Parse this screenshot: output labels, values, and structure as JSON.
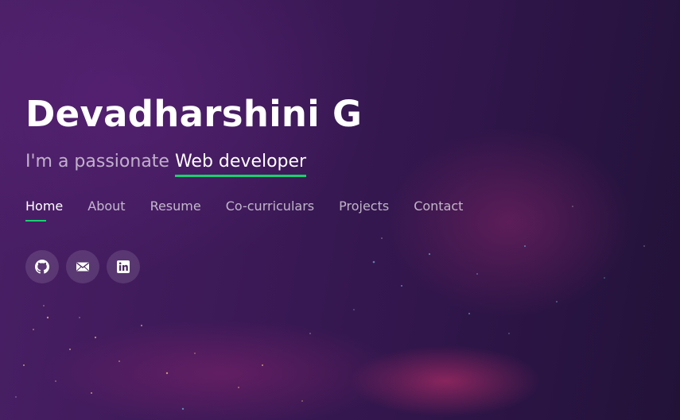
{
  "header": {
    "name": "Devadharshini G",
    "tagline_prefix": "I'm a passionate",
    "tagline_typed": "Web developer"
  },
  "nav": {
    "items": [
      {
        "label": "Home",
        "active": true
      },
      {
        "label": "About",
        "active": false
      },
      {
        "label": "Resume",
        "active": false
      },
      {
        "label": "Co-curriculars",
        "active": false
      },
      {
        "label": "Projects",
        "active": false
      },
      {
        "label": "Contact",
        "active": false
      }
    ]
  },
  "social": {
    "links": [
      {
        "icon": "github-icon"
      },
      {
        "icon": "mail-icon"
      },
      {
        "icon": "linkedin-icon"
      }
    ]
  },
  "colors": {
    "accent": "#18d26e",
    "background": "#3b1956",
    "text": "#ffffff"
  }
}
